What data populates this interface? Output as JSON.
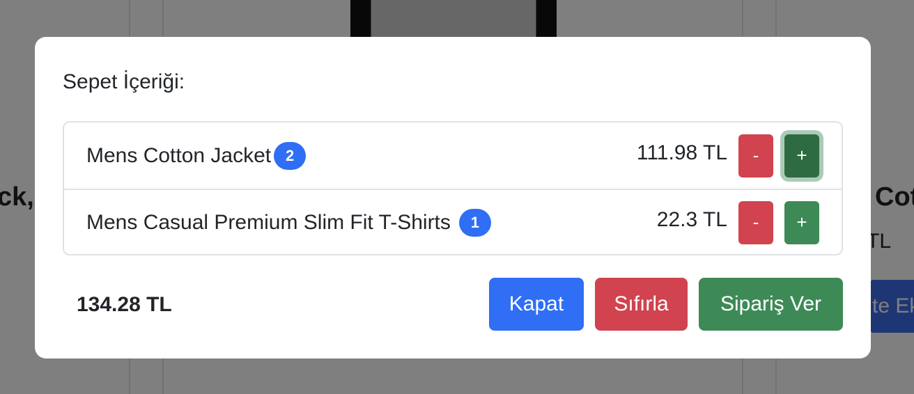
{
  "background": {
    "left_title_fragment": "ck,",
    "right_title_fragment": "Cot",
    "right_price_fragment": "TL",
    "right_button_fragment": "te Ek"
  },
  "modal": {
    "title": "Sepet İçeriği:",
    "items": [
      {
        "name": "Mens Cotton Jacket",
        "quantity": "2",
        "price": "111.98 TL",
        "minus_label": "-",
        "plus_label": "+"
      },
      {
        "name": "Mens Casual Premium Slim Fit T-Shirts",
        "quantity": "1",
        "price": "22.3 TL",
        "minus_label": "-",
        "plus_label": "+"
      }
    ],
    "total": "134.28 TL",
    "buttons": {
      "close": "Kapat",
      "reset": "Sıfırla",
      "order": "Sipariş Ver"
    }
  },
  "colors": {
    "primary": "#2f6ef5",
    "danger": "#d0434f",
    "success": "#3e8a57"
  }
}
